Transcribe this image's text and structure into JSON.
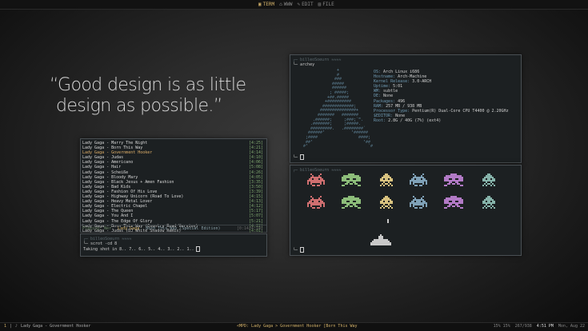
{
  "topbar": {
    "tabs": [
      {
        "label": "TERM",
        "icon": "terminal-icon",
        "active": true
      },
      {
        "label": "WWW",
        "icon": "globe-icon",
        "active": false
      },
      {
        "label": "EDIT",
        "icon": "pencil-icon",
        "active": false
      },
      {
        "label": "FILE",
        "icon": "folder-icon",
        "active": false
      }
    ]
  },
  "quote": {
    "line1": "“Good design is as little",
    "line2": "design as possible.”"
  },
  "playlist": {
    "rows": [
      {
        "title": "Lady Gaga - Marry The Night",
        "time": "[4:25]"
      },
      {
        "title": "Lady Gaga - Born This Way",
        "time": "[4:21]"
      },
      {
        "title": "Lady Gaga - Government Hooker",
        "time": "[4:14]",
        "highlight": true
      },
      {
        "title": "Lady Gaga - Judas",
        "time": "[4:10]"
      },
      {
        "title": "Lady Gaga - Americano",
        "time": "[4:06]"
      },
      {
        "title": "Lady Gaga - Hair",
        "time": "[5:08]"
      },
      {
        "title": "Lady Gaga - Scheiße",
        "time": "[4:26]"
      },
      {
        "title": "Lady Gaga - Bloody Mary",
        "time": "[4:05]"
      },
      {
        "title": "Lady Gaga - Black Jesus + Amen Fashion",
        "time": "[3:35]"
      },
      {
        "title": "Lady Gaga - Bad Kids",
        "time": "[3:50]"
      },
      {
        "title": "Lady Gaga - Fashion Of His Love",
        "time": "[3:39]"
      },
      {
        "title": "Lady Gaga - Highway Unicorn (Road To Love)",
        "time": "[4:15]"
      },
      {
        "title": "Lady Gaga - Heavy Metal Lover",
        "time": "[4:13]"
      },
      {
        "title": "Lady Gaga - Electric Chapel",
        "time": "[4:12]"
      },
      {
        "title": "Lady Gaga - The Queen",
        "time": "[5:17]"
      },
      {
        "title": "Lady Gaga - You And I",
        "time": "[5:07]"
      },
      {
        "title": "Lady Gaga - The Edge Of Glory",
        "time": "[5:21]"
      },
      {
        "title": "Lady Gaga - Born This Way (Country Road Version)",
        "time": "[4:22]"
      },
      {
        "title": "Lady Gaga - Judas (DJ White Shadow Remix)",
        "time": "[4:01]"
      }
    ],
    "status": {
      "label": "Playing: Ner",
      "artist": "Lady Gaga",
      "album": "Born This Way (Special Edition)",
      "position": "[0:14/4:14]"
    }
  },
  "scrot": {
    "prompt": "┌─ billeoSoeurn ≈≈≈≈",
    "command": "└─ scrot -cd 8",
    "output": "Taking shot in 8.. 7.. 6.. 5.. 4.. 3.. 2.. 1.. "
  },
  "archey": {
    "prompt": "┌─ billeoSoeurn ≈≈≈≈",
    "command": "└─ archey",
    "footer": "└─ ",
    "logo": "                +\n                #\n               ###\n              #####\n              ######\n             ; #####;\n            +##.#####\n           +##########\n          #############;\n         ###############+\n        #######   #######\n      .######;     ;###;`\".\n     .#######;     ;#####.\n     #########.   .########`\n    ######'           '######\n   ;####                 ####;\n   ##'                     '##\n  #'                         `#",
    "info": [
      {
        "key": "OS:",
        "value": "Arch Linux i686"
      },
      {
        "key": "Hostname:",
        "value": "Arch-Machine"
      },
      {
        "key": "Kernel Release:",
        "value": "3.0-ARCH"
      },
      {
        "key": "Uptime:",
        "value": "5:01"
      },
      {
        "key": "WM:",
        "value": "subtle"
      },
      {
        "key": "DE:",
        "value": "None"
      },
      {
        "key": "Packages:",
        "value": "496"
      },
      {
        "key": "RAM:",
        "value": "257 MB / 938 MB"
      },
      {
        "key": "Processor Type:",
        "value": "Pentium(R) Dual-Core CPU T4400 @ 2.20GHz"
      },
      {
        "key": "$EDITOR:",
        "value": "None"
      },
      {
        "key": "Root:",
        "value": "2.8G / 40G (7%) (ext4)"
      }
    ]
  },
  "invaders": {
    "prompt": "┌─ billeoSoeurn ≈≈≈≈",
    "footer": "└─ ",
    "colors": [
      "#cf6f70",
      "#8dbd7a",
      "#d8c27f",
      "#7fa1b7",
      "#b27ac6",
      "#86b3aa"
    ],
    "player_color": "#c8c8c8"
  },
  "bottombar": {
    "left_ws": "1",
    "left_sep": "|",
    "left_icon": "♪",
    "left_text": "Lady Gaga - Government Hooker",
    "mid": "<MPD: Lady Gaga > Government Hooker [Born This Way",
    "cpu": "15% 15%",
    "mem": "267/938",
    "time": "4:51 PM",
    "date": "Mon, Aug 22"
  }
}
